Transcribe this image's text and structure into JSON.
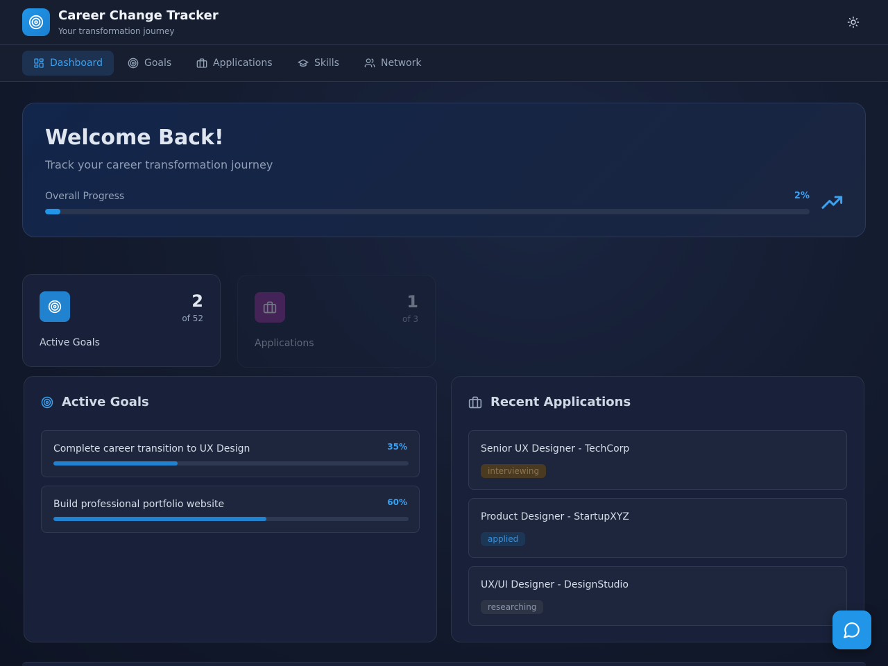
{
  "header": {
    "title": "Career Change Tracker",
    "subtitle": "Your transformation journey",
    "theme_icon": "sun-icon"
  },
  "nav": {
    "items": [
      {
        "label": "Dashboard",
        "icon": "dashboard-icon",
        "active": true
      },
      {
        "label": "Goals",
        "icon": "target-icon",
        "active": false
      },
      {
        "label": "Applications",
        "icon": "briefcase-icon",
        "active": false
      },
      {
        "label": "Skills",
        "icon": "graduation-cap-icon",
        "active": false
      },
      {
        "label": "Network",
        "icon": "users-icon",
        "active": false
      }
    ]
  },
  "welcome": {
    "title": "Welcome Back!",
    "subtitle": "Track your career transformation journey",
    "progress_label": "Overall Progress",
    "progress_value": "2%",
    "progress_fraction": 0.02
  },
  "stats": [
    {
      "value": "2",
      "of": "of 52",
      "label": "Active Goals",
      "icon": "target-icon"
    },
    {
      "value": "1",
      "of": "of 3",
      "label": "Applications",
      "icon": "briefcase-icon"
    }
  ],
  "goals_panel": {
    "title": "Active Goals",
    "goals": [
      {
        "title": "Complete career transition to UX Design",
        "percent": "35%",
        "fraction": 0.35
      },
      {
        "title": "Build professional portfolio website",
        "percent": "60%",
        "fraction": 0.6
      }
    ]
  },
  "applications_panel": {
    "title": "Recent Applications",
    "applications": [
      {
        "title": "Senior UX Designer - TechCorp",
        "status": "interviewing"
      },
      {
        "title": "Product Designer - StartupXYZ",
        "status": "applied"
      },
      {
        "title": "UX/UI Designer - DesignStudio",
        "status": "researching"
      }
    ]
  },
  "colors": {
    "accent": "#2196e8",
    "background": "#141c30",
    "applications_icon_bg": "#8b2f8f"
  },
  "chat_button_icon": "chat-bubble-icon"
}
